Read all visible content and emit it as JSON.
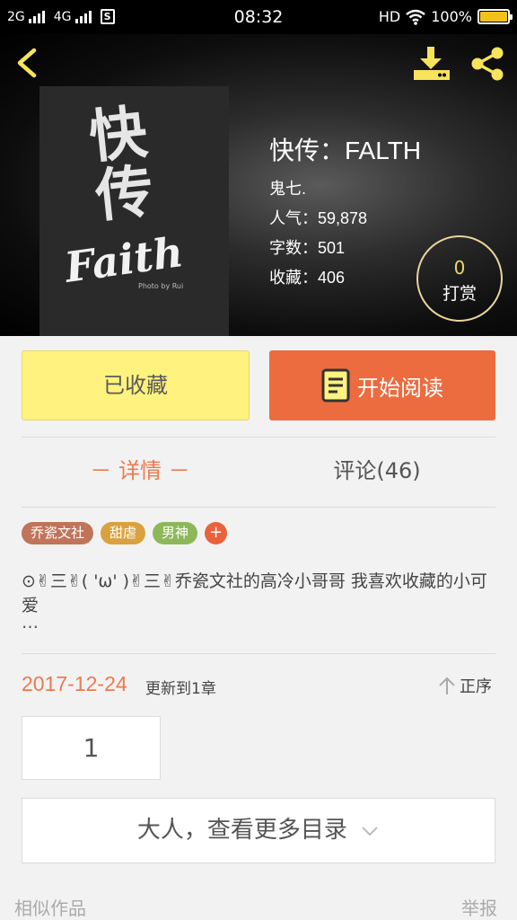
{
  "status_bar": {
    "net1": "2G",
    "net2": "4G",
    "sim_label": "S",
    "time": "08:32",
    "hd": "HD",
    "battery": "100%"
  },
  "book": {
    "title": "快传：FALTH",
    "author": "鬼七.",
    "popularity_label": "人气：",
    "popularity": "59,878",
    "words_label": "字数：",
    "words": "501",
    "favorites_label": "收藏：",
    "favorites": "406"
  },
  "cover": {
    "title_zh": "快传",
    "title_en": "Faith",
    "sub": "Photo by Rui"
  },
  "tip": {
    "count": "0",
    "label": "打赏"
  },
  "actions": {
    "collected": "已收藏",
    "read": "开始阅读"
  },
  "tabs": {
    "details": "－ 详情 －",
    "comments": "评论(46)"
  },
  "tags": [
    {
      "label": "乔瓷文社",
      "color": "#c0745a"
    },
    {
      "label": "甜虐",
      "color": "#d9a23e"
    },
    {
      "label": "男神",
      "color": "#8cb85a"
    }
  ],
  "tag_add": "+",
  "description": "⊙✌三✌( 'ω' )✌三✌乔瓷文社的高冷小哥哥   我喜欢收藏的小可爱",
  "description_more": "…",
  "update": {
    "date": "2017-12-24",
    "text": "更新到1章",
    "sort_label": "正序"
  },
  "page_number": "1",
  "more_catalog": "大人，查看更多目录",
  "footer": {
    "similar": "相似作品",
    "report": "举报"
  },
  "colors": {
    "accent": "#ec6b3f",
    "collected_bg": "#fff27e",
    "tip_border": "#e8d59a",
    "icon_yellow": "#f7e35c"
  }
}
